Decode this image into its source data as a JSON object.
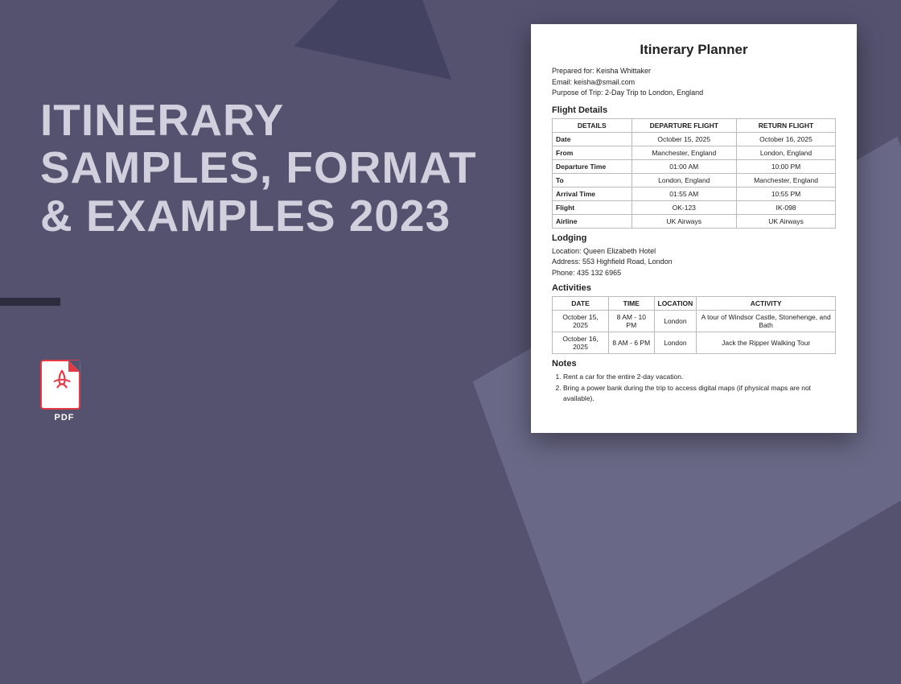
{
  "headline": "ITINERARY SAMPLES, FORMAT & EXAMPLES 2023",
  "pdf_label": "PDF",
  "doc": {
    "title": "Itinerary Planner",
    "meta": {
      "prepared": "Prepared for: Keisha Whittaker",
      "email": "Email: keisha@smail.com",
      "purpose": "Purpose of Trip: 2-Day Trip to London, England"
    },
    "flight": {
      "heading": "Flight Details",
      "cols": [
        "DETAILS",
        "DEPARTURE FLIGHT",
        "RETURN FLIGHT"
      ],
      "rows": [
        [
          "Date",
          "October 15, 2025",
          "October 16, 2025"
        ],
        [
          "From",
          "Manchester, England",
          "London, England"
        ],
        [
          "Departure Time",
          "01:00 AM",
          "10:00 PM"
        ],
        [
          "To",
          "London, England",
          "Manchester, England"
        ],
        [
          "Arrival Time",
          "01:55 AM",
          "10:55 PM"
        ],
        [
          "Flight",
          "OK-123",
          "IK-098"
        ],
        [
          "Airline",
          "UK Airways",
          "UK Airways"
        ]
      ]
    },
    "lodging": {
      "heading": "Lodging",
      "location": "Location: Queen Elizabeth Hotel",
      "address": "Address: 553 Highfield Road, London",
      "phone": "Phone: 435 132 6965"
    },
    "activities": {
      "heading": "Activities",
      "cols": [
        "DATE",
        "TIME",
        "LOCATION",
        "ACTIVITY"
      ],
      "rows": [
        [
          "October 15, 2025",
          "8 AM - 10 PM",
          "London",
          "A tour of Windsor Castle, Stonehenge, and Bath"
        ],
        [
          "October 16, 2025",
          "8 AM - 6 PM",
          "London",
          "Jack the Ripper Walking Tour"
        ]
      ]
    },
    "notes": {
      "heading": "Notes",
      "items": [
        "Rent a car for the entire 2-day vacation.",
        "Bring a power bank during the trip to access digital maps (if physical maps are not available)."
      ]
    }
  }
}
